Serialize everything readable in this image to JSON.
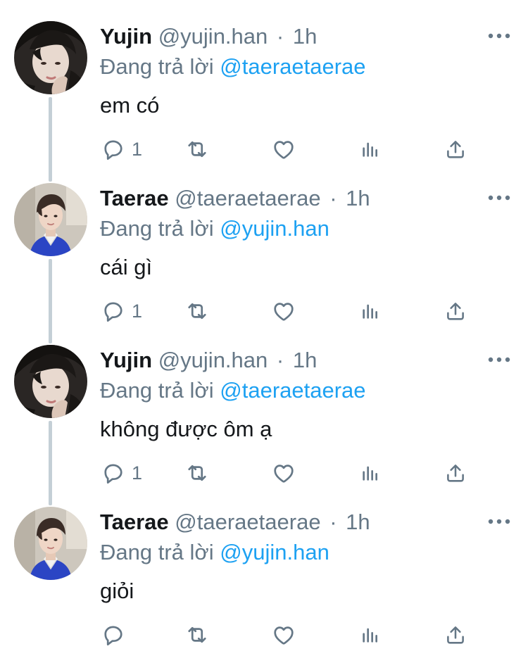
{
  "tweets": [
    {
      "name": "Yujin",
      "handle": "@yujin.han",
      "separator": "·",
      "time": "1h",
      "reply_prefix": "Đang trả lời",
      "reply_to": "@taeraetaerae",
      "text": "em có",
      "reply_count": "1",
      "avatar": "avatar-dark-portrait"
    },
    {
      "name": "Taerae",
      "handle": "@taeraetaerae",
      "separator": "·",
      "time": "1h",
      "reply_prefix": "Đang trả lời",
      "reply_to": "@yujin.han",
      "text": "cái gì",
      "reply_count": "1",
      "avatar": "avatar-blue-sweater"
    },
    {
      "name": "Yujin",
      "handle": "@yujin.han",
      "separator": "·",
      "time": "1h",
      "reply_prefix": "Đang trả lời",
      "reply_to": "@taeraetaerae",
      "text": "không được ôm ạ",
      "reply_count": "1",
      "avatar": "avatar-dark-portrait"
    },
    {
      "name": "Taerae",
      "handle": "@taeraetaerae",
      "separator": "·",
      "time": "1h",
      "reply_prefix": "Đang trả lời",
      "reply_to": "@yujin.han",
      "text": "giỏi",
      "reply_count": "",
      "avatar": "avatar-blue-sweater"
    }
  ],
  "icons": {
    "reply": "reply-icon",
    "retweet": "retweet-icon",
    "like": "like-icon",
    "stats": "stats-icon",
    "share": "share-icon",
    "more": "more-icon"
  },
  "colors": {
    "name": "#14171a",
    "secondary": "#657786",
    "mention": "#1da1f2",
    "thread_line": "#c4cfd6"
  }
}
